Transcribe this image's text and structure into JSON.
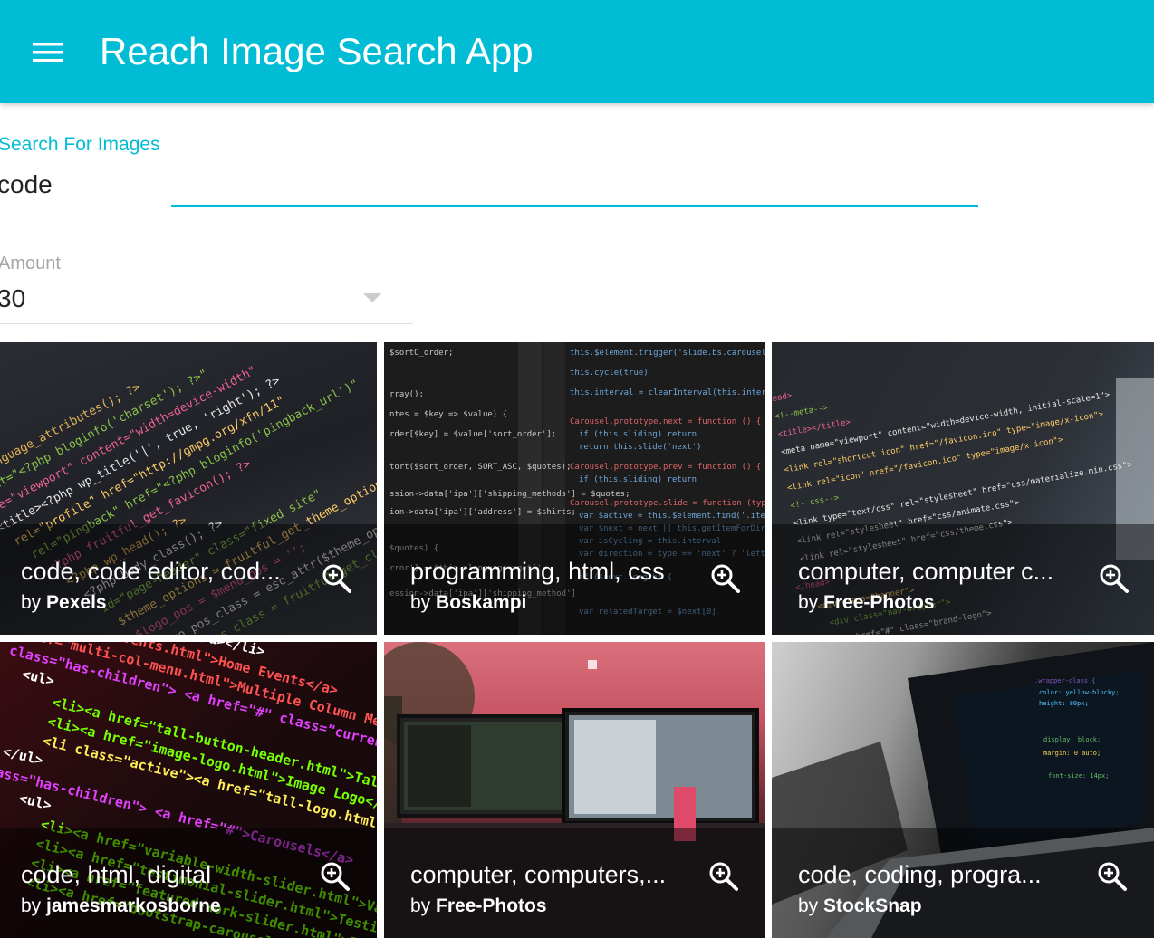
{
  "appbar": {
    "title": "Reach Image Search App",
    "menu_icon": "menu-icon",
    "color": "#00bcd4"
  },
  "search": {
    "label": "Search For Images",
    "value": "code"
  },
  "amount": {
    "label": "Amount",
    "value": "30"
  },
  "results": [
    {
      "title": "code, code editor, cod...",
      "by_prefix": "by",
      "author": "Pexels",
      "zoom_icon": "zoom-in-icon"
    },
    {
      "title": "programming, html, css",
      "by_prefix": "by",
      "author": "Boskampi",
      "zoom_icon": "zoom-in-icon"
    },
    {
      "title": "computer, computer c...",
      "by_prefix": "by",
      "author": "Free-Photos",
      "zoom_icon": "zoom-in-icon"
    },
    {
      "title": "code, html, digital",
      "by_prefix": "by",
      "author": "jamesmarkosborne",
      "zoom_icon": "zoom-in-icon"
    },
    {
      "title": "computer, computers,...",
      "by_prefix": "by",
      "author": "Free-Photos",
      "zoom_icon": "zoom-in-icon"
    },
    {
      "title": "code, coding, progra...",
      "by_prefix": "by",
      "author": "StockSnap",
      "zoom_icon": "zoom-in-icon"
    }
  ]
}
